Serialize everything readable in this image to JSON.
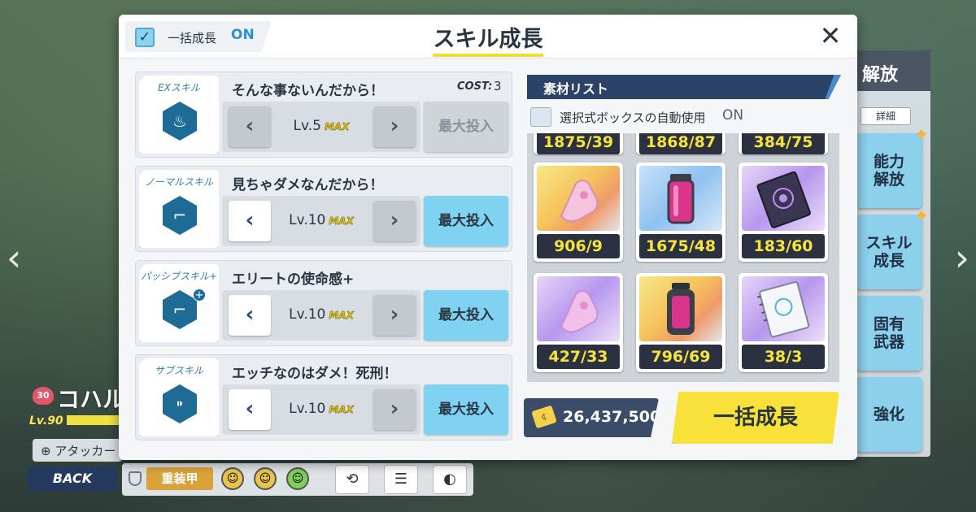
{
  "modal": {
    "title": "スキル成長",
    "bulk_toggle": {
      "label": "一括成長",
      "state": "ON"
    },
    "close_glyph": "✕"
  },
  "skills": [
    {
      "type": "EXスキル",
      "name": "そんな事ないんだから！",
      "cost_label": "COST:",
      "cost": "3",
      "level": "Lv.5",
      "max_tag": "MAX",
      "invest_label": "最大投入",
      "invest_enabled": false,
      "icon": "ex-skill-icon"
    },
    {
      "type": "ノーマルスキル",
      "name": "見ちゃダメなんだから！",
      "level": "Lv.10",
      "max_tag": "MAX",
      "invest_label": "最大投入",
      "invest_enabled": true,
      "icon": "gun-icon"
    },
    {
      "type": "パッシブスキル+",
      "name": "エリートの使命感+",
      "level": "Lv.10",
      "max_tag": "MAX",
      "invest_label": "最大投入",
      "invest_enabled": true,
      "icon": "gun-plus-icon"
    },
    {
      "type": "サブスキル",
      "name": "エッチなのはダメ！死刑！",
      "level": "Lv.10",
      "max_tag": "MAX",
      "invest_label": "最大投入",
      "invest_enabled": true,
      "icon": "bullet-icon"
    }
  ],
  "materials": {
    "header": "素材リスト",
    "auto_box": {
      "label": "選択式ボックスの自動使用",
      "state": "ON"
    },
    "partial_row": [
      "1875/39",
      "1868/87",
      "384/75"
    ],
    "items": [
      {
        "count": "906/9",
        "bg": "gold",
        "icon": "glove-artifact-icon"
      },
      {
        "count": "1675/48",
        "bg": "blue",
        "icon": "canister-icon"
      },
      {
        "count": "183/60",
        "bg": "purple",
        "icon": "book-icon"
      },
      {
        "count": "427/33",
        "bg": "purple",
        "icon": "glove-artifact-icon"
      },
      {
        "count": "796/69",
        "bg": "gold",
        "icon": "canister-icon"
      },
      {
        "count": "38/3",
        "bg": "purple",
        "icon": "notebook-icon"
      }
    ]
  },
  "credits": {
    "value": "26,437,500",
    "icon": "credit-icon",
    "icon_text": "¢"
  },
  "bulk_grow_button": "一括成長",
  "background": {
    "right_panel": {
      "header": "解放",
      "detail": "詳細",
      "buttons": [
        "能力解放",
        "スキル成長",
        "固有武器",
        "強化"
      ]
    },
    "character": {
      "level_badge": "30",
      "name": "コハル",
      "level": "Lv.90",
      "role": "アタッカー"
    },
    "back": "BACK",
    "armor": "重装甲",
    "nav_prev": "‹",
    "nav_next": "›"
  },
  "colors": {
    "accent_yellow": "#f7e13a",
    "accent_blue": "#7fd2f1",
    "navy": "#2b4366",
    "count_text": "#f6e43a"
  }
}
